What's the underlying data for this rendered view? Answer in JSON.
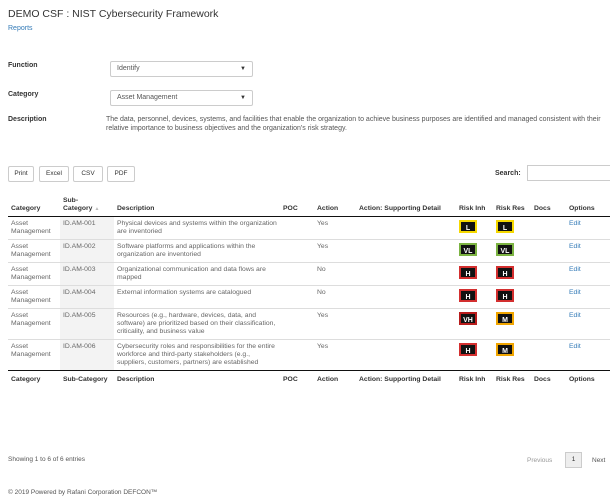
{
  "page": {
    "title": "DEMO CSF : NIST Cybersecurity Framework",
    "breadcrumb": "Reports"
  },
  "filters": {
    "function_label": "Function",
    "function_value": "Identify",
    "category_label": "Category",
    "category_value": "Asset Management",
    "description_label": "Description",
    "description_text": "The data, personnel, devices, systems, and facilities that enable the organization to achieve business purposes are identified and managed consistent with their relative importance to business objectives and the organization's risk strategy."
  },
  "toolbar": {
    "print": "Print",
    "excel": "Excel",
    "csv": "CSV",
    "pdf": "PDF",
    "search_label": "Search:"
  },
  "table": {
    "headers": [
      "Category",
      "Sub-Category",
      "Description",
      "POC",
      "Action",
      "Action: Supporting Detail",
      "Risk Inh",
      "Risk Res",
      "Docs",
      "Options"
    ],
    "rows": [
      {
        "category": "Asset Management",
        "sub": "ID.AM-001",
        "desc": "Physical devices and systems within the organization are inventoried",
        "poc": "",
        "action": "Yes",
        "detail": "",
        "inh": "L",
        "res": "L",
        "docs": "",
        "opt": "Edit"
      },
      {
        "category": "Asset Management",
        "sub": "ID.AM-002",
        "desc": "Software platforms and applications within the organization are inventoried",
        "poc": "",
        "action": "Yes",
        "detail": "",
        "inh": "VL",
        "res": "VL",
        "docs": "",
        "opt": "Edit"
      },
      {
        "category": "Asset Management",
        "sub": "ID.AM-003",
        "desc": "Organizational communication and data flows are mapped",
        "poc": "",
        "action": "No",
        "detail": "",
        "inh": "H",
        "res": "H",
        "docs": "",
        "opt": "Edit"
      },
      {
        "category": "Asset Management",
        "sub": "ID.AM-004",
        "desc": "External information systems are catalogued",
        "poc": "",
        "action": "No",
        "detail": "",
        "inh": "H",
        "res": "H",
        "docs": "",
        "opt": "Edit"
      },
      {
        "category": "Asset Management",
        "sub": "ID.AM-005",
        "desc": "Resources (e.g., hardware, devices, data, and software) are prioritized based on their classification, criticality, and business value",
        "poc": "",
        "action": "Yes",
        "detail": "",
        "inh": "VH",
        "res": "M",
        "docs": "",
        "opt": "Edit"
      },
      {
        "category": "Asset Management",
        "sub": "ID.AM-006",
        "desc": "Cybersecurity roles and responsibilities for the entire workforce and third-party stakeholders (e.g., suppliers, customers, partners) are established",
        "poc": "",
        "action": "Yes",
        "detail": "",
        "inh": "H",
        "res": "M",
        "docs": "",
        "opt": "Edit"
      }
    ]
  },
  "risk_colors": {
    "VL": "#7cb342",
    "L": "#f5d800",
    "M": "#f0a500",
    "H": "#d32f2f",
    "VH": "#b71c1c"
  },
  "pagination": {
    "info": "Showing 1 to 6 of 6 entries",
    "previous": "Previous",
    "current": "1",
    "next": "Next"
  },
  "footer": "© 2019 Powered by Rafani Corporation DEFCON™"
}
